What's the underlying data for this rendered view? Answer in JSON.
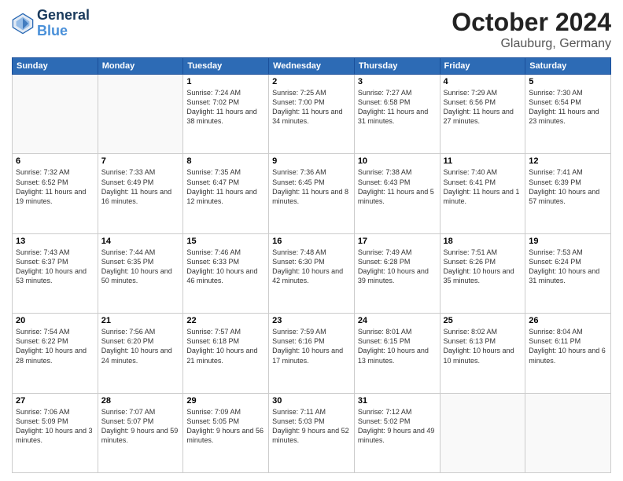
{
  "header": {
    "logo_line1": "General",
    "logo_line2": "Blue",
    "main_title": "October 2024",
    "subtitle": "Glauburg, Germany"
  },
  "days_of_week": [
    "Sunday",
    "Monday",
    "Tuesday",
    "Wednesday",
    "Thursday",
    "Friday",
    "Saturday"
  ],
  "weeks": [
    [
      {
        "day": "",
        "info": ""
      },
      {
        "day": "",
        "info": ""
      },
      {
        "day": "1",
        "info": "Sunrise: 7:24 AM\nSunset: 7:02 PM\nDaylight: 11 hours and 38 minutes."
      },
      {
        "day": "2",
        "info": "Sunrise: 7:25 AM\nSunset: 7:00 PM\nDaylight: 11 hours and 34 minutes."
      },
      {
        "day": "3",
        "info": "Sunrise: 7:27 AM\nSunset: 6:58 PM\nDaylight: 11 hours and 31 minutes."
      },
      {
        "day": "4",
        "info": "Sunrise: 7:29 AM\nSunset: 6:56 PM\nDaylight: 11 hours and 27 minutes."
      },
      {
        "day": "5",
        "info": "Sunrise: 7:30 AM\nSunset: 6:54 PM\nDaylight: 11 hours and 23 minutes."
      }
    ],
    [
      {
        "day": "6",
        "info": "Sunrise: 7:32 AM\nSunset: 6:52 PM\nDaylight: 11 hours and 19 minutes."
      },
      {
        "day": "7",
        "info": "Sunrise: 7:33 AM\nSunset: 6:49 PM\nDaylight: 11 hours and 16 minutes."
      },
      {
        "day": "8",
        "info": "Sunrise: 7:35 AM\nSunset: 6:47 PM\nDaylight: 11 hours and 12 minutes."
      },
      {
        "day": "9",
        "info": "Sunrise: 7:36 AM\nSunset: 6:45 PM\nDaylight: 11 hours and 8 minutes."
      },
      {
        "day": "10",
        "info": "Sunrise: 7:38 AM\nSunset: 6:43 PM\nDaylight: 11 hours and 5 minutes."
      },
      {
        "day": "11",
        "info": "Sunrise: 7:40 AM\nSunset: 6:41 PM\nDaylight: 11 hours and 1 minute."
      },
      {
        "day": "12",
        "info": "Sunrise: 7:41 AM\nSunset: 6:39 PM\nDaylight: 10 hours and 57 minutes."
      }
    ],
    [
      {
        "day": "13",
        "info": "Sunrise: 7:43 AM\nSunset: 6:37 PM\nDaylight: 10 hours and 53 minutes."
      },
      {
        "day": "14",
        "info": "Sunrise: 7:44 AM\nSunset: 6:35 PM\nDaylight: 10 hours and 50 minutes."
      },
      {
        "day": "15",
        "info": "Sunrise: 7:46 AM\nSunset: 6:33 PM\nDaylight: 10 hours and 46 minutes."
      },
      {
        "day": "16",
        "info": "Sunrise: 7:48 AM\nSunset: 6:30 PM\nDaylight: 10 hours and 42 minutes."
      },
      {
        "day": "17",
        "info": "Sunrise: 7:49 AM\nSunset: 6:28 PM\nDaylight: 10 hours and 39 minutes."
      },
      {
        "day": "18",
        "info": "Sunrise: 7:51 AM\nSunset: 6:26 PM\nDaylight: 10 hours and 35 minutes."
      },
      {
        "day": "19",
        "info": "Sunrise: 7:53 AM\nSunset: 6:24 PM\nDaylight: 10 hours and 31 minutes."
      }
    ],
    [
      {
        "day": "20",
        "info": "Sunrise: 7:54 AM\nSunset: 6:22 PM\nDaylight: 10 hours and 28 minutes."
      },
      {
        "day": "21",
        "info": "Sunrise: 7:56 AM\nSunset: 6:20 PM\nDaylight: 10 hours and 24 minutes."
      },
      {
        "day": "22",
        "info": "Sunrise: 7:57 AM\nSunset: 6:18 PM\nDaylight: 10 hours and 21 minutes."
      },
      {
        "day": "23",
        "info": "Sunrise: 7:59 AM\nSunset: 6:16 PM\nDaylight: 10 hours and 17 minutes."
      },
      {
        "day": "24",
        "info": "Sunrise: 8:01 AM\nSunset: 6:15 PM\nDaylight: 10 hours and 13 minutes."
      },
      {
        "day": "25",
        "info": "Sunrise: 8:02 AM\nSunset: 6:13 PM\nDaylight: 10 hours and 10 minutes."
      },
      {
        "day": "26",
        "info": "Sunrise: 8:04 AM\nSunset: 6:11 PM\nDaylight: 10 hours and 6 minutes."
      }
    ],
    [
      {
        "day": "27",
        "info": "Sunrise: 7:06 AM\nSunset: 5:09 PM\nDaylight: 10 hours and 3 minutes."
      },
      {
        "day": "28",
        "info": "Sunrise: 7:07 AM\nSunset: 5:07 PM\nDaylight: 9 hours and 59 minutes."
      },
      {
        "day": "29",
        "info": "Sunrise: 7:09 AM\nSunset: 5:05 PM\nDaylight: 9 hours and 56 minutes."
      },
      {
        "day": "30",
        "info": "Sunrise: 7:11 AM\nSunset: 5:03 PM\nDaylight: 9 hours and 52 minutes."
      },
      {
        "day": "31",
        "info": "Sunrise: 7:12 AM\nSunset: 5:02 PM\nDaylight: 9 hours and 49 minutes."
      },
      {
        "day": "",
        "info": ""
      },
      {
        "day": "",
        "info": ""
      }
    ]
  ]
}
